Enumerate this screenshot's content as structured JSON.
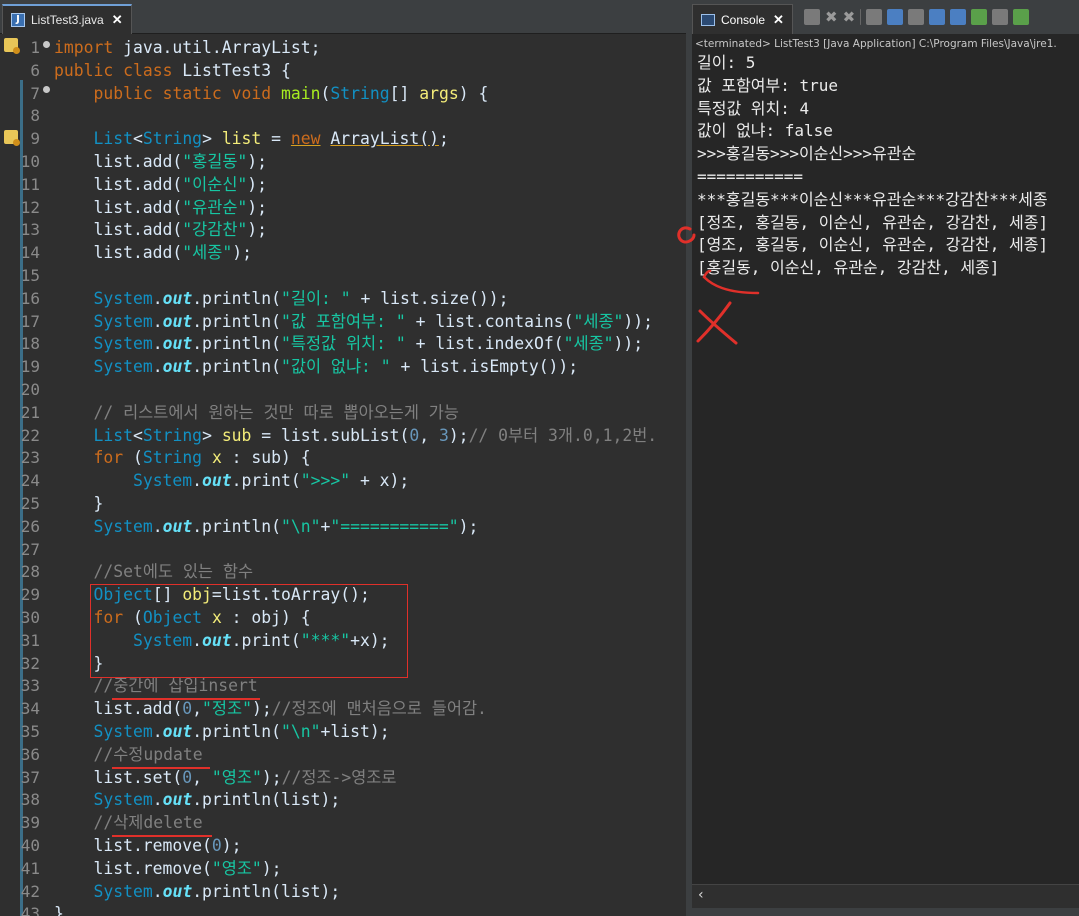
{
  "editor": {
    "tab_label": "ListTest3.java",
    "close_glyph": "✕",
    "lines": [
      {
        "n": "1",
        "html": "<span class=\"kw\">import</span> java.util.ArrayList;"
      },
      {
        "n": "6",
        "html": "<span class=\"kw\">public</span> <span class=\"kw\">class</span> ListTest3 {"
      },
      {
        "n": "7",
        "html": "    <span class=\"kw\">public</span> <span class=\"kw\">static</span> <span class=\"kw\">void</span> <span class=\"mth\">main</span>(<span class=\"ty\">String</span>[] <span class=\"var\">args</span>) {"
      },
      {
        "n": "8",
        "html": ""
      },
      {
        "n": "9",
        "html": "    <span class=\"ty\">List</span>&lt;<span class=\"ty\">String</span>&gt; <span class=\"var\">list</span> = <span class=\"kw ulin\">new</span> <span class=\"ulin\">ArrayList</span><span class=\"ulin\">()</span>;"
      },
      {
        "n": "10",
        "html": "    list.add(<span class=\"str\">\"홍길동\"</span>);"
      },
      {
        "n": "11",
        "html": "    list.add(<span class=\"str\">\"이순신\"</span>);"
      },
      {
        "n": "12",
        "html": "    list.add(<span class=\"str\">\"유관순\"</span>);"
      },
      {
        "n": "13",
        "html": "    list.add(<span class=\"str\">\"강감찬\"</span>);"
      },
      {
        "n": "14",
        "html": "    list.add(<span class=\"str\">\"세종\"</span>);"
      },
      {
        "n": "15",
        "html": ""
      },
      {
        "n": "16",
        "html": "    <span class=\"ty\">System</span>.<span class=\"fld\">out</span>.println(<span class=\"str\">\"길이: \"</span> + list.size());"
      },
      {
        "n": "17",
        "html": "    <span class=\"ty\">System</span>.<span class=\"fld\">out</span>.println(<span class=\"str\">\"값 포함여부: \"</span> + list.contains(<span class=\"str\">\"세종\"</span>));"
      },
      {
        "n": "18",
        "html": "    <span class=\"ty\">System</span>.<span class=\"fld\">out</span>.println(<span class=\"str\">\"특정값 위치: \"</span> + list.indexOf(<span class=\"str\">\"세종\"</span>));"
      },
      {
        "n": "19",
        "html": "    <span class=\"ty\">System</span>.<span class=\"fld\">out</span>.println(<span class=\"str\">\"값이 없냐: \"</span> + list.isEmpty());"
      },
      {
        "n": "20",
        "html": ""
      },
      {
        "n": "21",
        "html": "    <span class=\"cm\">// 리스트에서 원하는 것만 따로 뽑아오는게 가능</span>"
      },
      {
        "n": "22",
        "html": "    <span class=\"ty\">List</span>&lt;<span class=\"ty\">String</span>&gt; <span class=\"var\">sub</span> = list.subList(<span class=\"num\">0</span>, <span class=\"num\">3</span>);<span class=\"cm\">// 0부터 3개.0,1,2번.</span>"
      },
      {
        "n": "23",
        "html": "    <span class=\"kw\">for</span> (<span class=\"ty\">String</span> <span class=\"var\">x</span> : sub) {"
      },
      {
        "n": "24",
        "html": "        <span class=\"ty\">System</span>.<span class=\"fld\">out</span>.print(<span class=\"str\">\"&gt;&gt;&gt;\"</span> + x);"
      },
      {
        "n": "25",
        "html": "    }"
      },
      {
        "n": "26",
        "html": "    <span class=\"ty\">System</span>.<span class=\"fld\">out</span>.println(<span class=\"str\">\"\\n\"</span>+<span class=\"str\">\"===========\"</span>);"
      },
      {
        "n": "27",
        "html": ""
      },
      {
        "n": "28",
        "html": "    <span class=\"cm\">//Set에도 있는 함수</span>"
      },
      {
        "n": "29",
        "html": "    <span class=\"ty\">Object</span>[] <span class=\"var\">obj</span>=list.toArray();"
      },
      {
        "n": "30",
        "html": "    <span class=\"kw\">for</span> (<span class=\"ty\">Object</span> <span class=\"var\">x</span> : obj) {"
      },
      {
        "n": "31",
        "html": "        <span class=\"ty\">System</span>.<span class=\"fld\">out</span>.print(<span class=\"str\">\"***\"</span>+x);"
      },
      {
        "n": "32",
        "html": "    }"
      },
      {
        "n": "33",
        "html": "    <span class=\"cm\">//중간에 삽입insert</span>"
      },
      {
        "n": "34",
        "html": "    list.add(<span class=\"num\">0</span>,<span class=\"str\">\"정조\"</span>);<span class=\"cm\">//정조에 맨처음으로 들어감.</span>"
      },
      {
        "n": "35",
        "html": "    <span class=\"ty\">System</span>.<span class=\"fld\">out</span>.println(<span class=\"str\">\"\\n\"</span>+list);"
      },
      {
        "n": "36",
        "html": "    <span class=\"cm\">//수정update</span>"
      },
      {
        "n": "37",
        "html": "    list.set(<span class=\"num\">0</span>, <span class=\"str\">\"영조\"</span>);<span class=\"cm\">//정조-&gt;영조로</span>"
      },
      {
        "n": "38",
        "html": "    <span class=\"ty\">System</span>.<span class=\"fld\">out</span>.println(list);"
      },
      {
        "n": "39",
        "html": "    <span class=\"cm\">//삭제delete</span>"
      },
      {
        "n": "40",
        "html": "    list.remove(<span class=\"num\">0</span>);"
      },
      {
        "n": "41",
        "html": "    list.remove(<span class=\"str\">\"영조\"</span>);"
      },
      {
        "n": "42",
        "html": "    <span class=\"ty\">System</span>.<span class=\"fld\">out</span>.println(list);"
      },
      {
        "n": "43",
        "html": "}"
      }
    ]
  },
  "console": {
    "tab_label": "Console",
    "close_glyph": "✕",
    "status": "<terminated> ListTest3 [Java Application] C:\\Program Files\\Java\\jre1.",
    "output": [
      "길이: 5",
      "값 포함여부: true",
      "특정값 위치: 4",
      "값이 없냐: false",
      ">>>홍길동>>>이순신>>>유관순",
      "===========",
      "***홍길동***이순신***유관순***강감찬***세종",
      "[정조, 홍길동, 이순신, 유관순, 강감찬, 세종]",
      "[영조, 홍길동, 이순신, 유관순, 강감찬, 세종]",
      "[홍길동, 이순신, 유관순, 강감찬, 세종]"
    ],
    "scroll_left_glyph": "‹"
  },
  "colors": {
    "editor_bg": "#2f2f2f",
    "console_bg": "#262626",
    "keyword": "#cc6c1d",
    "type": "#1290c3",
    "string": "#17c6a3",
    "annotation_red": "#e0302a"
  },
  "icons": {
    "editor_tab": "java-file-icon",
    "console_tab": "console-icon",
    "gutter": [
      "warning-icon",
      "fold-icon"
    ]
  }
}
